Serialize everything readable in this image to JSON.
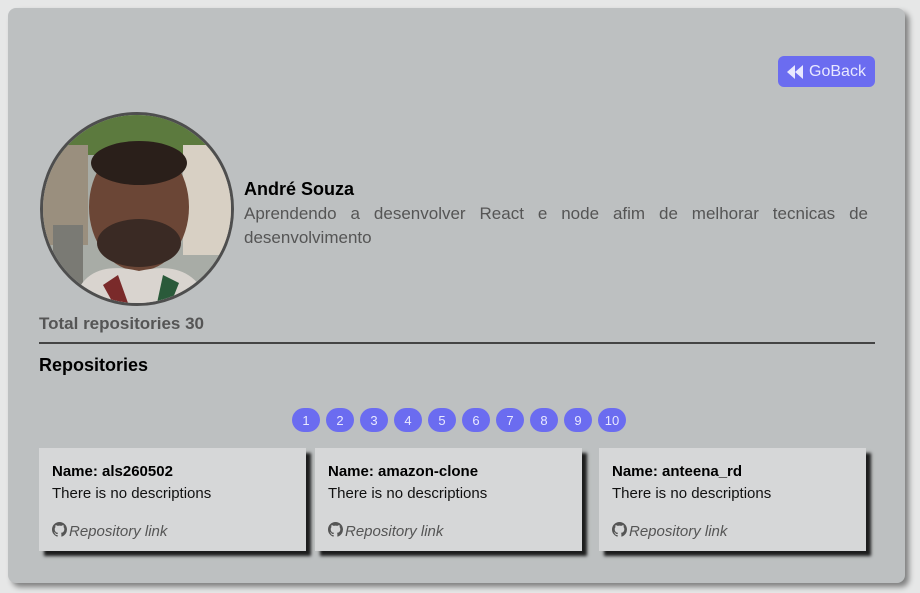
{
  "header": {
    "goback_label": "GoBack"
  },
  "user": {
    "name": "André Souza",
    "bio": "Aprendendo a desenvolver React e node afim de melhorar tecnicas de desenvolvimento",
    "total_repositories_label": "Total repositories 30"
  },
  "repos": {
    "heading": "Repositories",
    "pages": [
      "1",
      "2",
      "3",
      "4",
      "5",
      "6",
      "7",
      "8",
      "9",
      "10"
    ],
    "items": [
      {
        "name": "Name: als260502",
        "description": "There is no descriptions",
        "link_label": "Repository link"
      },
      {
        "name": "Name: amazon-clone",
        "description": "There is no descriptions",
        "link_label": "Repository link"
      },
      {
        "name": "Name: anteena_rd",
        "description": "There is no descriptions",
        "link_label": "Repository link"
      }
    ]
  },
  "colors": {
    "accent": "#6b6cf0",
    "card_bg": "#bdc0c1",
    "repo_bg": "#d6d7d8"
  },
  "icons": {
    "goback": "fast-backward-icon",
    "repo_link": "github-icon"
  }
}
